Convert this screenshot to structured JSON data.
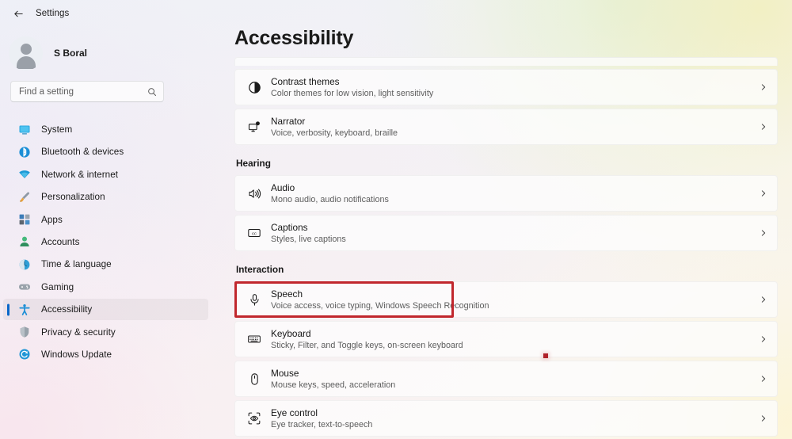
{
  "window": {
    "back_icon": "back-arrow-icon",
    "title": "Settings"
  },
  "account": {
    "name": "S Boral",
    "avatar_icon": "avatar-icon"
  },
  "search": {
    "placeholder": "Find a setting",
    "value": "",
    "icon": "search-icon"
  },
  "sidebar": {
    "items": [
      {
        "label": "System",
        "icon": "system-icon",
        "selected": false
      },
      {
        "label": "Bluetooth & devices",
        "icon": "bluetooth-icon",
        "selected": false
      },
      {
        "label": "Network & internet",
        "icon": "wifi-icon",
        "selected": false
      },
      {
        "label": "Personalization",
        "icon": "paintbrush-icon",
        "selected": false
      },
      {
        "label": "Apps",
        "icon": "apps-icon",
        "selected": false
      },
      {
        "label": "Accounts",
        "icon": "accounts-icon",
        "selected": false
      },
      {
        "label": "Time & language",
        "icon": "clock-globe-icon",
        "selected": false
      },
      {
        "label": "Gaming",
        "icon": "gamepad-icon",
        "selected": false
      },
      {
        "label": "Accessibility",
        "icon": "accessibility-person-icon",
        "selected": true
      },
      {
        "label": "Privacy & security",
        "icon": "shield-icon",
        "selected": false
      },
      {
        "label": "Windows Update",
        "icon": "update-icon",
        "selected": false
      }
    ]
  },
  "main": {
    "page_title": "Accessibility",
    "sections": [
      {
        "label": "",
        "rows": [
          {
            "title": "Contrast themes",
            "subtitle": "Color themes for low vision, light sensitivity",
            "icon": "contrast-circle-icon",
            "chevron": "chevron-right-icon",
            "annotated": false
          },
          {
            "title": "Narrator",
            "subtitle": "Voice, verbosity, keyboard, braille",
            "icon": "narrator-monitor-icon",
            "chevron": "chevron-right-icon",
            "annotated": false
          }
        ]
      },
      {
        "label": "Hearing",
        "rows": [
          {
            "title": "Audio",
            "subtitle": "Mono audio, audio notifications",
            "icon": "speaker-icon",
            "chevron": "chevron-right-icon",
            "annotated": false
          },
          {
            "title": "Captions",
            "subtitle": "Styles, live captions",
            "icon": "closed-captions-icon",
            "chevron": "chevron-right-icon",
            "annotated": false
          }
        ]
      },
      {
        "label": "Interaction",
        "rows": [
          {
            "title": "Speech",
            "subtitle": "Voice access, voice typing, Windows Speech Recognition",
            "icon": "microphone-icon",
            "chevron": "chevron-right-icon",
            "annotated": true
          },
          {
            "title": "Keyboard",
            "subtitle": "Sticky, Filter, and Toggle keys, on-screen keyboard",
            "icon": "keyboard-icon",
            "chevron": "chevron-right-icon",
            "annotated": false
          },
          {
            "title": "Mouse",
            "subtitle": "Mouse keys, speed, acceleration",
            "icon": "mouse-icon",
            "chevron": "chevron-right-icon",
            "annotated": false
          },
          {
            "title": "Eye control",
            "subtitle": "Eye tracker, text-to-speech",
            "icon": "eye-control-icon",
            "chevron": "chevron-right-icon",
            "annotated": false
          }
        ]
      }
    ]
  },
  "annotation": {
    "highlight_color": "#c1272d",
    "cursor_marker_color": "#b0222a"
  }
}
